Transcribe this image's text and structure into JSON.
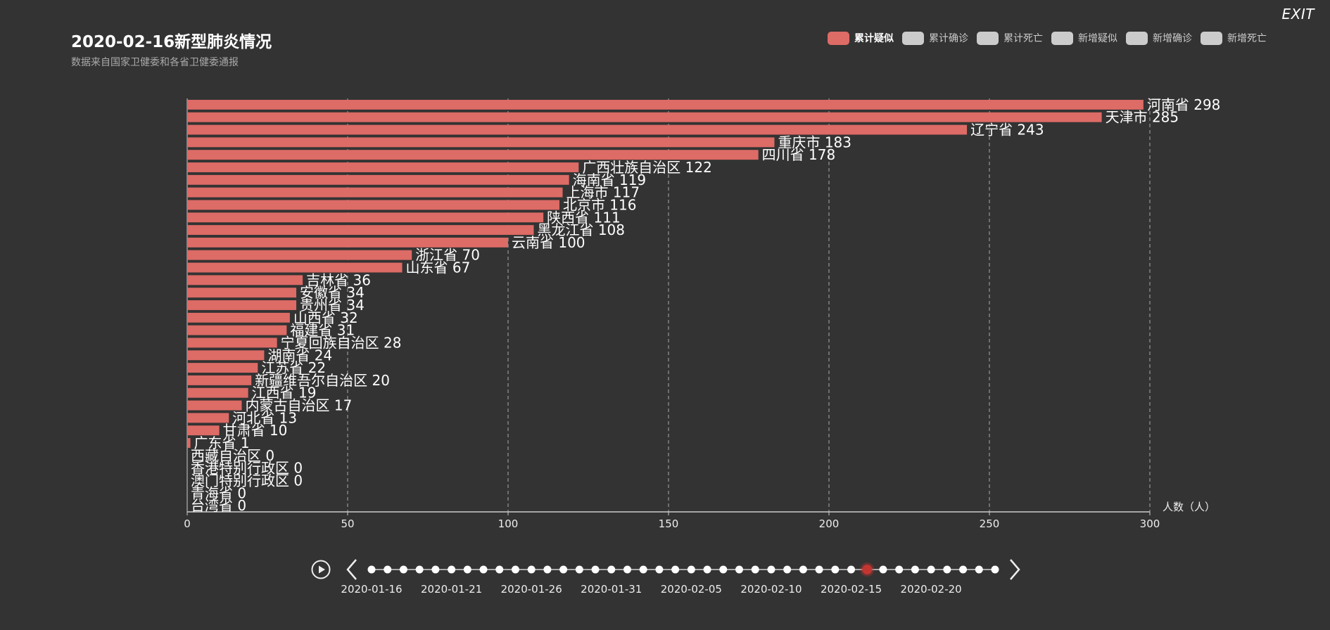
{
  "header": {
    "exit_label": "EXIT",
    "title": "2020-02-16新型肺炎情况",
    "subtitle": "数据来自国家卫健委和各省卫健委通报"
  },
  "legend": [
    {
      "label": "累计疑似",
      "active": true
    },
    {
      "label": "累计确诊",
      "active": false
    },
    {
      "label": "累计死亡",
      "active": false
    },
    {
      "label": "新增疑似",
      "active": false
    },
    {
      "label": "新增确诊",
      "active": false
    },
    {
      "label": "新增死亡",
      "active": false
    }
  ],
  "colors": {
    "bar": "#dd6b66",
    "axis": "#cccccc",
    "grid": "#aaaaaa",
    "timeline_active": "#c23531",
    "timeline_node": "#ffffff"
  },
  "icons": {
    "play": "play-icon",
    "prev": "chevron-left-icon",
    "next": "chevron-right-icon"
  },
  "chart_data": {
    "type": "bar",
    "orientation": "horizontal",
    "xlabel": "人数（人）",
    "xlim": [
      0,
      300
    ],
    "xticks": [
      0,
      50,
      100,
      150,
      200,
      250,
      300
    ],
    "grid": "vertical-dashed",
    "series": [
      {
        "name": "累计疑似",
        "values": [
          298,
          285,
          243,
          183,
          178,
          122,
          119,
          117,
          116,
          111,
          108,
          100,
          70,
          67,
          36,
          34,
          34,
          32,
          31,
          28,
          24,
          22,
          20,
          19,
          17,
          13,
          10,
          1,
          0,
          0,
          0,
          0,
          0
        ]
      }
    ],
    "categories": [
      "河南省",
      "天津市",
      "辽宁省",
      "重庆市",
      "四川省",
      "广西壮族自治区",
      "海南省",
      "上海市",
      "北京市",
      "陕西省",
      "黑龙江省",
      "云南省",
      "浙江省",
      "山东省",
      "吉林省",
      "安徽省",
      "贵州省",
      "山西省",
      "福建省",
      "宁夏回族自治区",
      "湖南省",
      "江苏省",
      "新疆维吾尔自治区",
      "江西省",
      "内蒙古自治区",
      "河北省",
      "甘肃省",
      "广东省",
      "西藏自治区",
      "香港特别行政区",
      "澳门特别行政区",
      "青海省",
      "台湾省"
    ]
  },
  "timeline": {
    "node_count": 40,
    "current_index": 31,
    "labels": [
      "2020-01-16",
      "2020-01-21",
      "2020-01-26",
      "2020-01-31",
      "2020-02-05",
      "2020-02-10",
      "2020-02-15",
      "2020-02-20"
    ]
  }
}
